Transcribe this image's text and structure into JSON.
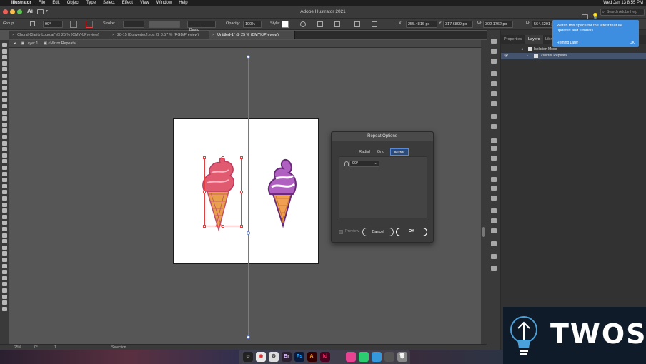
{
  "menubar": {
    "app": "Illustrator",
    "items": [
      "File",
      "Edit",
      "Object",
      "Type",
      "Select",
      "Effect",
      "View",
      "Window",
      "Help"
    ],
    "clock": "Wed Jan 13  8:55 PM"
  },
  "titlebar": {
    "title": "Adobe Illustrator 2021",
    "search_placeholder": "Search Adobe Help"
  },
  "controlbar": {
    "selection_label": "Group",
    "angle": "90°",
    "stroke_label": "Stroke:",
    "brush_label": "Basic",
    "opacity_label": "Opacity:",
    "opacity_value": "100%",
    "style_label": "Style:",
    "x_label": "X:",
    "x_value": "255.4816 px",
    "y_label": "Y:",
    "y_value": "317.6899 px",
    "w_label": "W:",
    "w_value": "302.1762 px",
    "h_label": "H:",
    "h_value": "564.6291 px"
  },
  "tabs": [
    {
      "label": "Choral-Clarity-Logo.ai* @ 25 % (CMYK/Preview)"
    },
    {
      "label": "28-15 [Converted].eps @ 8.57 % (RGB/Preview)"
    },
    {
      "label": "Untitled-1* @ 25 % (CMYK/Preview)"
    }
  ],
  "breadcrumb": {
    "layer": "Layer 1",
    "item": "<Mirror Repeat>"
  },
  "dialog": {
    "title": "Repeat Options",
    "tabs": [
      "Radial",
      "Grid",
      "Mirror"
    ],
    "active_tab": "Mirror",
    "angle_value": "90°",
    "preview_label": "Preview",
    "cancel_label": "Cancel",
    "ok_label": "OK"
  },
  "right_panel": {
    "tabs": [
      "Properties",
      "Layers",
      "Libr"
    ],
    "active_tab": "Layers",
    "rows": [
      {
        "label": "Isolation Mode"
      },
      {
        "label": "<Mirror Repeat>"
      }
    ]
  },
  "tooltip": {
    "message": "Watch this space for the latest feature updates and tutorials.",
    "remind_label": "Remind Later",
    "ok_label": "OK"
  },
  "statusbar": {
    "zoom": "25%",
    "angle": "0°",
    "artboard": "1",
    "tool": "Selection"
  },
  "dock": {
    "apps": [
      "Br",
      "Ps",
      "Ai",
      "Id"
    ]
  },
  "watermark": {
    "text": "TWOS"
  },
  "colors": {
    "accent": "#3d8ee0",
    "selection": "#e04040",
    "axis": "#5a7ad6"
  }
}
